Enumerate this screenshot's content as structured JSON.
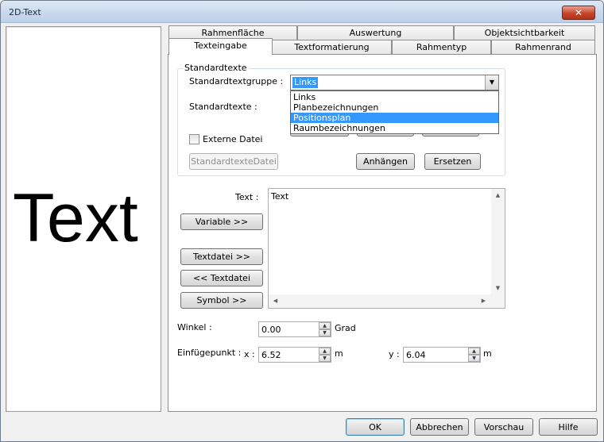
{
  "window": {
    "title": "2D-Text",
    "close_glyph": "✕"
  },
  "preview": {
    "text": "Text"
  },
  "tabs": {
    "row1": [
      "Rahmenfläche",
      "Auswertung",
      "Objektsichtbarkeit"
    ],
    "row2": [
      "Texteingabe",
      "Textformatierung",
      "Rahmentyp",
      "Rahmenrand"
    ],
    "active": "Texteingabe"
  },
  "standardtexte": {
    "group_label": "Standardtexte",
    "gruppe_label": "Standardtextgruppe :",
    "gruppe_value": "Links",
    "options": [
      "Links",
      "Planbezeichnungen",
      "Positionsplan",
      "Raumbezeichnungen"
    ],
    "highlighted_option": "Positionsplan",
    "texte_label": "Standardtexte :",
    "externe_datei_label": "Externe Datei",
    "externe_datei_checked": false,
    "datei_button": "StandardtexteDatei",
    "anhaengen_button": "Anhängen",
    "ersetzen_button": "Ersetzen"
  },
  "text_section": {
    "label": "Text :",
    "value": "Text",
    "variable_button": "Variable >>",
    "textdatei_out_button": "Textdatei >>",
    "textdatei_in_button": "<< Textdatei",
    "symbol_button": "Symbol >>"
  },
  "winkel": {
    "label": "Winkel :",
    "value": "0.00",
    "unit": "Grad"
  },
  "einfuegepunkt": {
    "label": "Einfügepunkt :",
    "x_label": "x :",
    "x_value": "6.52",
    "x_unit": "m",
    "y_label": "y :",
    "y_value": "6.04",
    "y_unit": "m"
  },
  "footer": {
    "ok": "OK",
    "abbrechen": "Abbrechen",
    "vorschau": "Vorschau",
    "hilfe": "Hilfe"
  }
}
